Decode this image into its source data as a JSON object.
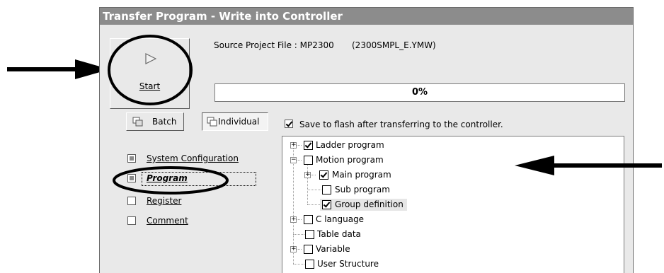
{
  "window": {
    "title": "Transfer Program - Write into Controller"
  },
  "start_button": {
    "label": "Start",
    "icon": "play-icon"
  },
  "source": {
    "label": "Source Project File : MP2300",
    "file": "(2300SMPL_E.YMW)"
  },
  "progress": {
    "text": "0%",
    "value": 0
  },
  "modes": {
    "batch_label": "Batch",
    "individual_label": "Individual",
    "selected": "Individual"
  },
  "save_flash": {
    "label": "Save to flash after transferring to the controller.",
    "checked": true
  },
  "categories": [
    {
      "label": "System Configuration",
      "state": "indeterminate"
    },
    {
      "label": "Program",
      "state": "indeterminate",
      "selected": true
    },
    {
      "label": "Register",
      "state": "unchecked"
    },
    {
      "label": "Comment",
      "state": "unchecked"
    }
  ],
  "tree": [
    {
      "label": "Ladder program",
      "checked": true,
      "level": 0,
      "expander": "+"
    },
    {
      "label": "Motion program",
      "checked": false,
      "level": 0,
      "expander": "-"
    },
    {
      "label": "Main program",
      "checked": true,
      "level": 1,
      "expander": "+"
    },
    {
      "label": "Sub program",
      "checked": false,
      "level": 1,
      "expander": ""
    },
    {
      "label": "Group definition",
      "checked": true,
      "level": 1,
      "expander": "",
      "selected": true
    },
    {
      "label": "C language",
      "checked": false,
      "level": 0,
      "expander": "+"
    },
    {
      "label": "Table data",
      "checked": false,
      "level": 0,
      "expander": ""
    },
    {
      "label": "Variable",
      "checked": false,
      "level": 0,
      "expander": "+"
    },
    {
      "label": "User Structure",
      "checked": false,
      "level": 0,
      "expander": ""
    }
  ],
  "colors": {
    "title_bar": "#8c8c8c",
    "dialog_bg": "#e9e9e9",
    "annotation": "#000000"
  }
}
